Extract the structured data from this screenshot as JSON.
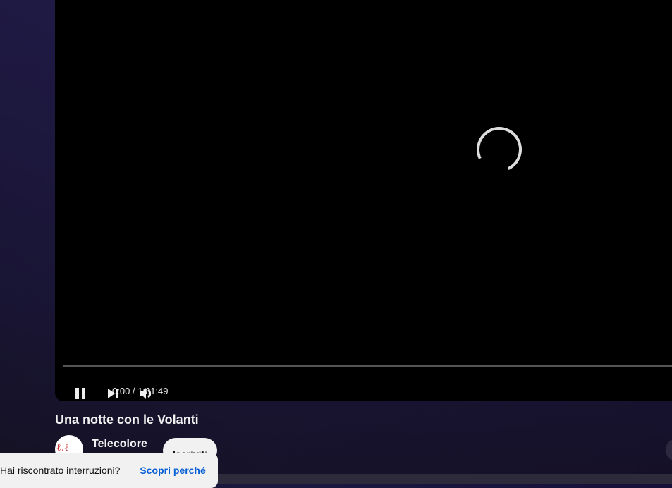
{
  "player": {
    "current_time": "0:00",
    "duration": "1:01:49",
    "time_display": "0:00 / 1:01:49",
    "progress_percent": 0,
    "state": "loading"
  },
  "video": {
    "title": "Una notte con le Volanti"
  },
  "channel": {
    "name": "Telecolore",
    "subscribe_label": "Iscriviti"
  },
  "toast": {
    "message": "Hai riscontrato interruzioni?",
    "link": "Scopri perché"
  },
  "colors": {
    "link": "#065fd4",
    "player_bg": "#000000"
  }
}
